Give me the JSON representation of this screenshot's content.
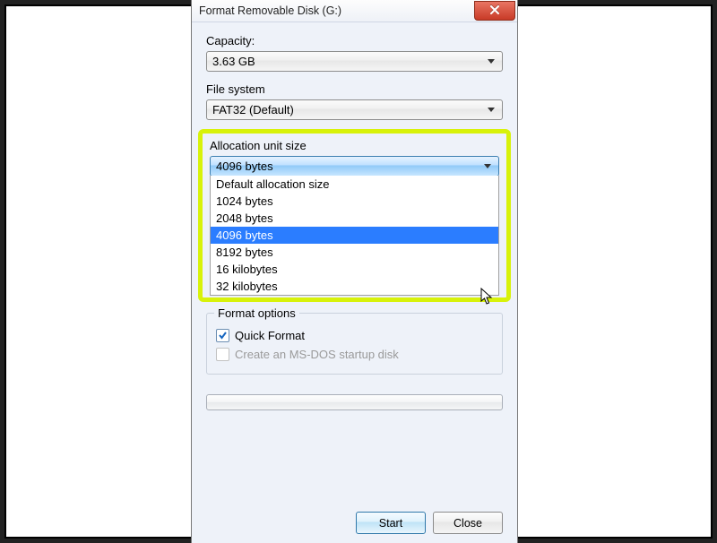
{
  "title": "Format Removable Disk (G:)",
  "capacity": {
    "label": "Capacity:",
    "value": "3.63 GB"
  },
  "filesystem": {
    "label": "File system",
    "value": "FAT32 (Default)"
  },
  "allocation": {
    "label": "Allocation unit size",
    "value": "4096 bytes",
    "options": [
      "Default allocation size",
      "1024 bytes",
      "2048 bytes",
      "4096 bytes",
      "8192 bytes",
      "16 kilobytes",
      "32 kilobytes"
    ],
    "selected_index": 3
  },
  "format_options": {
    "legend": "Format options",
    "quick_format": {
      "label": "Quick Format",
      "checked": true
    },
    "ms_dos": {
      "label": "Create an MS-DOS startup disk",
      "checked": false,
      "disabled": true
    }
  },
  "buttons": {
    "start": "Start",
    "close": "Close"
  },
  "colors": {
    "highlight_border": "#d8f20a",
    "selection": "#2b7dff"
  }
}
